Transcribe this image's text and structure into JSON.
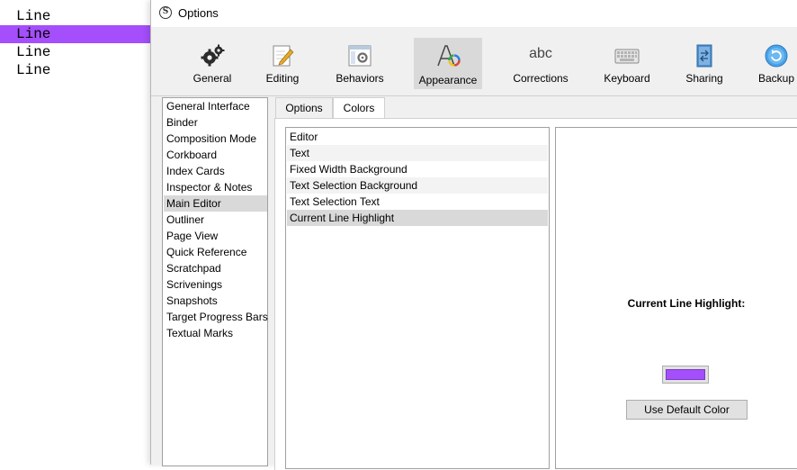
{
  "editor": {
    "lines": [
      "Line",
      "Line",
      "Line",
      "Line"
    ],
    "highlight_color": "#a54efb"
  },
  "window": {
    "title": "Options",
    "app_icon": "S"
  },
  "toolbar": {
    "items": [
      {
        "label": "General",
        "icon": "gears-icon"
      },
      {
        "label": "Editing",
        "icon": "pencil-paper-icon"
      },
      {
        "label": "Behaviors",
        "icon": "gear-window-icon"
      },
      {
        "label": "Appearance",
        "icon": "appearance-icon"
      },
      {
        "label": "Corrections",
        "icon": "abc-icon",
        "glyph": "abc"
      },
      {
        "label": "Keyboard",
        "icon": "keyboard-icon"
      },
      {
        "label": "Sharing",
        "icon": "sharing-icon"
      },
      {
        "label": "Backup",
        "icon": "backup-icon"
      }
    ],
    "active": "Appearance"
  },
  "categories": {
    "items": [
      "General Interface",
      "Binder",
      "Composition Mode",
      "Corkboard",
      "Index Cards",
      "Inspector & Notes",
      "Main Editor",
      "Outliner",
      "Page View",
      "Quick Reference",
      "Scratchpad",
      "Scrivenings",
      "Snapshots",
      "Target Progress Bars",
      "Textual Marks"
    ],
    "selected": "Main Editor"
  },
  "tabs": {
    "items": [
      "Options",
      "Colors"
    ],
    "active": "Colors"
  },
  "colors": {
    "items": [
      "Editor",
      "Text",
      "Fixed Width Background",
      "Text Selection Background",
      "Text Selection Text",
      "Current Line Highlight"
    ],
    "selected": "Current Line Highlight"
  },
  "preview": {
    "label": "Current Line Highlight:",
    "swatch_color": "#a54efb",
    "default_button": "Use Default Color"
  }
}
